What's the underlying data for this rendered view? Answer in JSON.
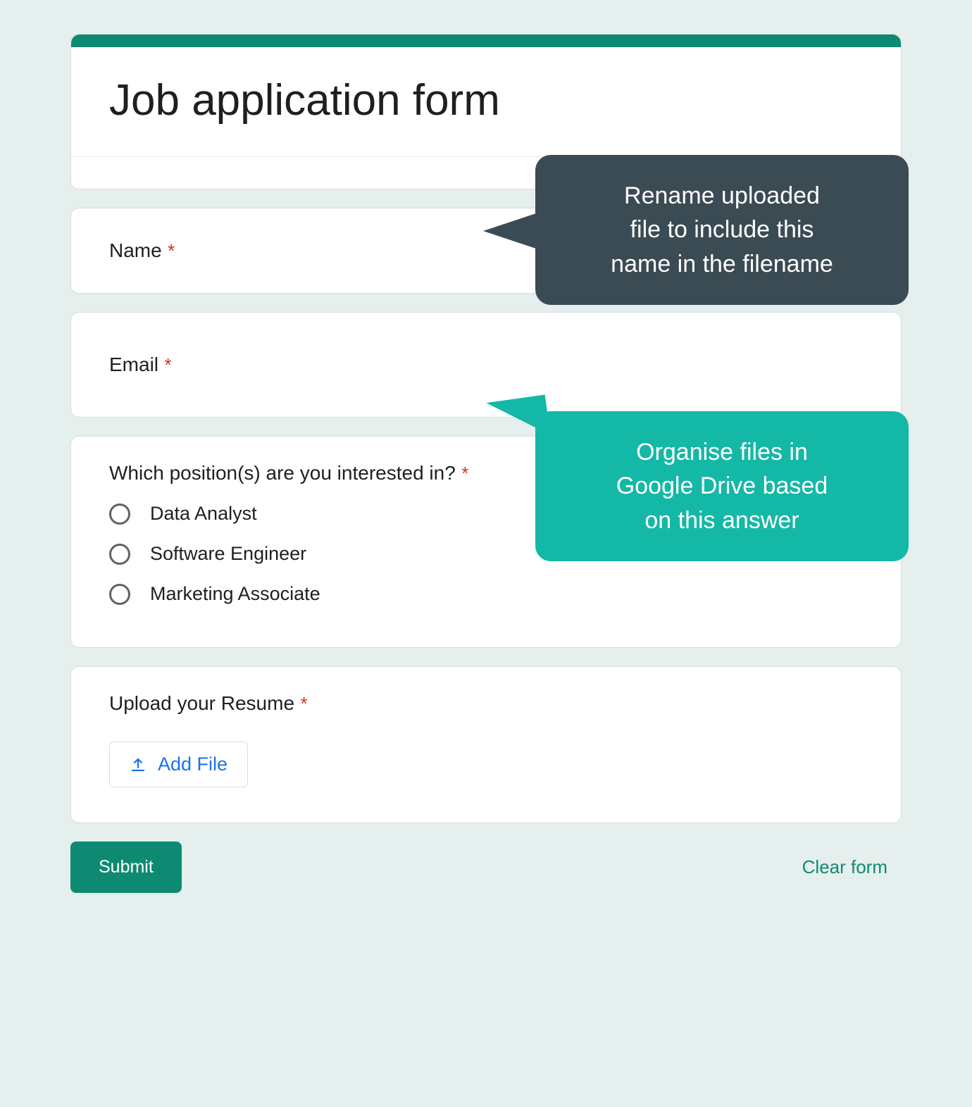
{
  "form": {
    "title": "Job application form",
    "required_marker": "*",
    "questions": {
      "name": {
        "label": "Name"
      },
      "email": {
        "label": "Email"
      },
      "position": {
        "label": "Which position(s) are you interested in?",
        "options": [
          "Data Analyst",
          "Software Engineer",
          "Marketing Associate"
        ]
      },
      "resume": {
        "label": "Upload your Resume",
        "button": "Add File"
      }
    },
    "submit_label": "Submit",
    "clear_label": "Clear form"
  },
  "callouts": {
    "rename": "Rename uploaded\nfile to include this\nname in the filename",
    "organise": "Organise files in\nGoogle Drive based\non this answer"
  },
  "colors": {
    "accent": "#0f8a72",
    "callout_dark": "#3b4b53",
    "callout_teal": "#14b8a6",
    "link_blue": "#1a73e8",
    "required_red": "#d93025"
  }
}
